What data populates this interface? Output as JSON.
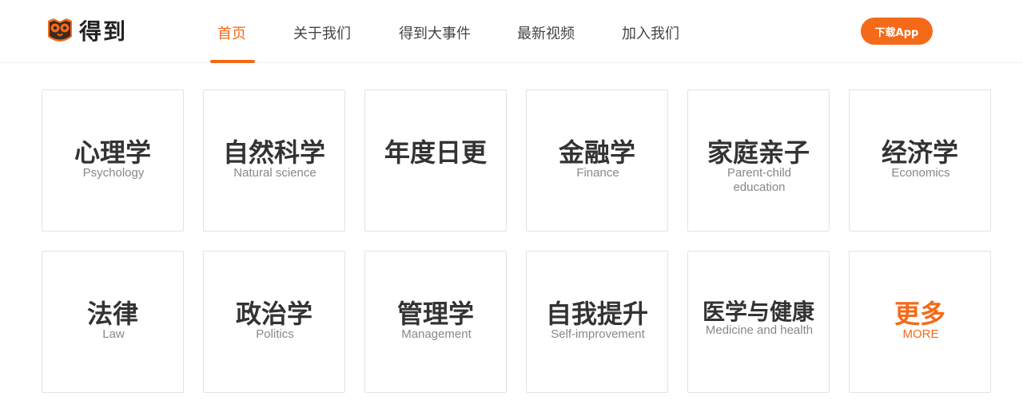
{
  "header": {
    "logo_text": "得到",
    "nav": [
      {
        "label": "首页",
        "active": true
      },
      {
        "label": "关于我们",
        "active": false
      },
      {
        "label": "得到大事件",
        "active": false
      },
      {
        "label": "最新视频",
        "active": false
      },
      {
        "label": "加入我们",
        "active": false
      }
    ],
    "download_label": "下载App"
  },
  "colors": {
    "accent": "#f46a18",
    "text": "#333333",
    "subtext": "#888888",
    "border": "#e3e3e3"
  },
  "categories": [
    {
      "title": "心理学",
      "subtitle": "Psychology"
    },
    {
      "title": "自然科学",
      "subtitle": "Natural science"
    },
    {
      "title": "年度日更",
      "subtitle": ""
    },
    {
      "title": "金融学",
      "subtitle": "Finance"
    },
    {
      "title": "家庭亲子",
      "subtitle": "Parent-child education"
    },
    {
      "title": "经济学",
      "subtitle": "Economics"
    },
    {
      "title": "法律",
      "subtitle": "Law"
    },
    {
      "title": "政治学",
      "subtitle": "Politics"
    },
    {
      "title": "管理学",
      "subtitle": "Management"
    },
    {
      "title": "自我提升",
      "subtitle": "Self-improvement"
    },
    {
      "title": "医学与健康",
      "subtitle": "Medicine and health"
    },
    {
      "title": "更多",
      "subtitle": "MORE"
    }
  ]
}
